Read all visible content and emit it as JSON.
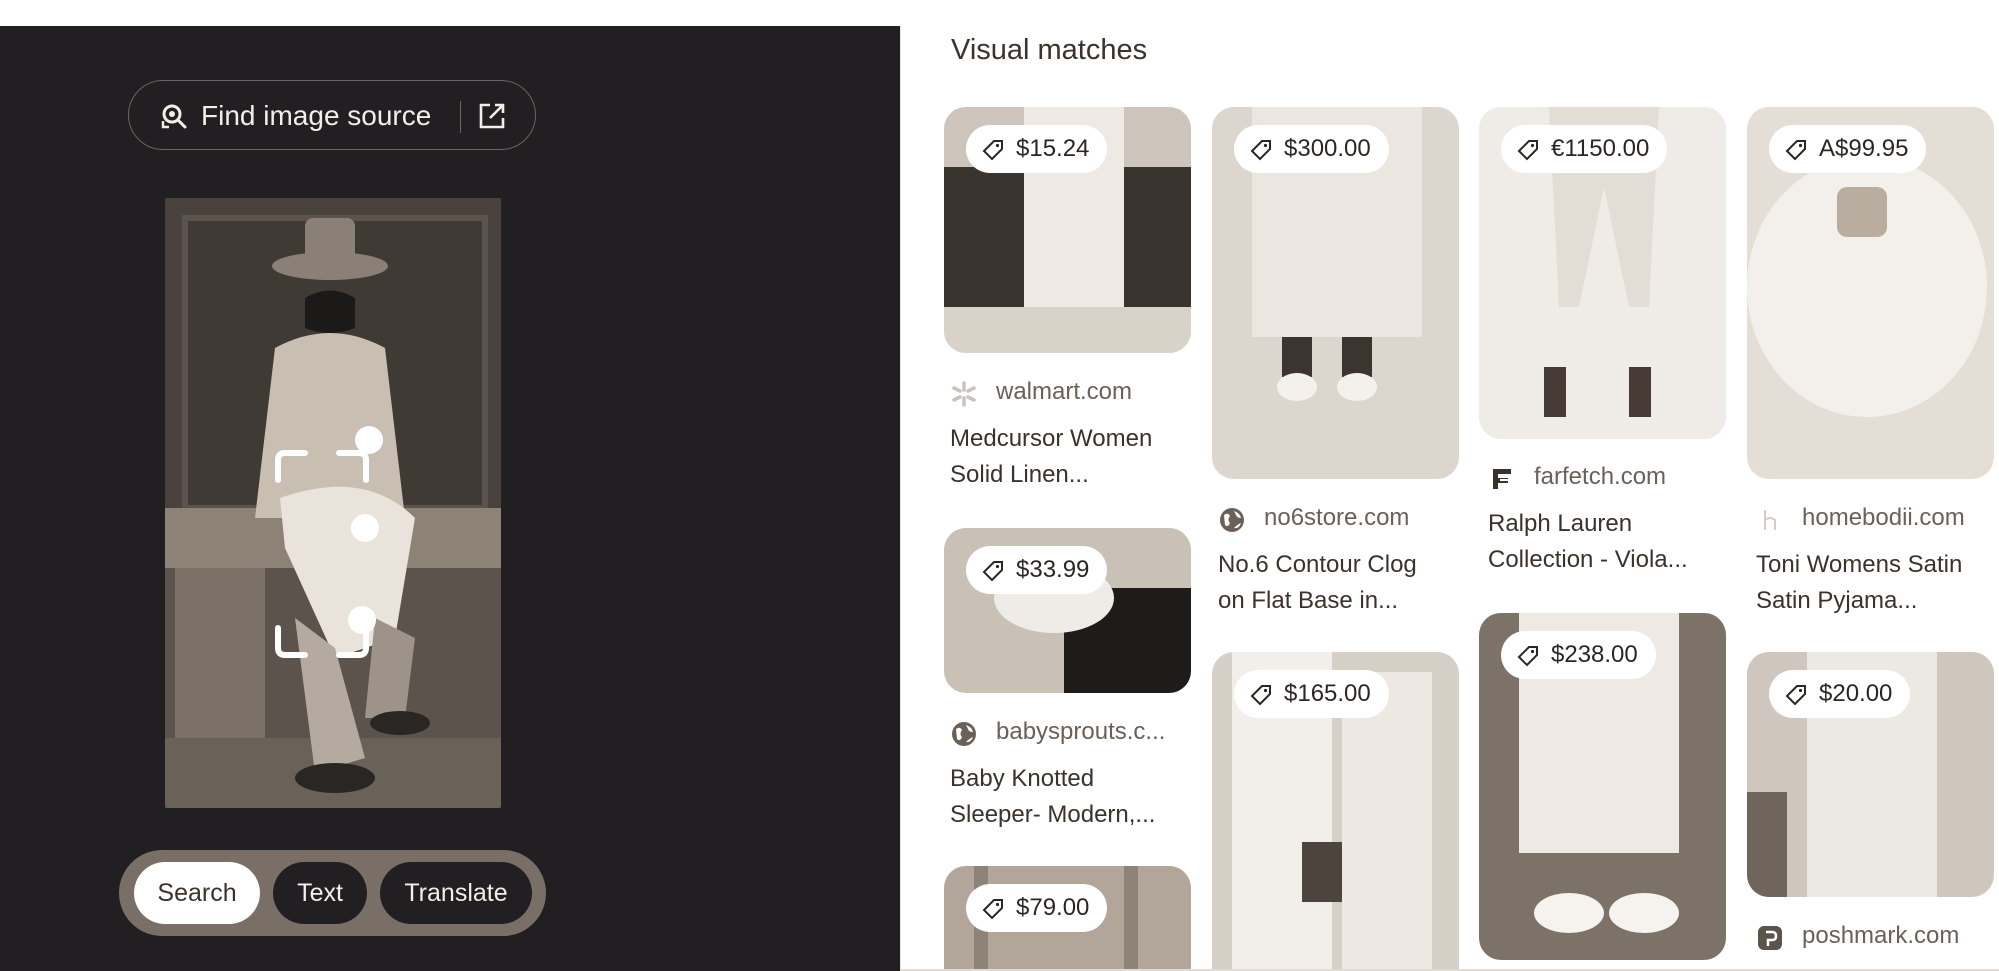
{
  "lens_panel": {
    "find_image_source_label": "Find image source",
    "modes": [
      {
        "label": "Search",
        "active": true
      },
      {
        "label": "Text",
        "active": false
      },
      {
        "label": "Translate",
        "active": false
      }
    ]
  },
  "results": {
    "section_title": "Visual matches",
    "items": [
      {
        "price": "$15.24",
        "source": "walmart.com",
        "source_icon": "walmart-spark-icon",
        "title_line1": "Medcursor Women",
        "title_line2": "Solid Linen..."
      },
      {
        "price": "$33.99",
        "source": "babysprouts.c...",
        "source_icon": "globe-icon",
        "title_line1": "Baby Knotted",
        "title_line2": "Sleeper- Modern,..."
      },
      {
        "price": "$79.00"
      },
      {
        "price": "$300.00",
        "source": "no6store.com",
        "source_icon": "globe-icon",
        "title_line1": "No.6 Contour Clog",
        "title_line2": "on Flat Base in..."
      },
      {
        "price": "$165.00"
      },
      {
        "price": "€1150.00",
        "source": "farfetch.com",
        "source_icon": "farfetch-icon",
        "title_line1": "Ralph Lauren",
        "title_line2": "Collection - Viola..."
      },
      {
        "price": "$238.00"
      },
      {
        "price": "A$99.95",
        "source": "homebodii.com",
        "source_icon": "homebodii-icon",
        "title_line1": "Toni Womens Satin",
        "title_line2": "Satin Pyjama..."
      },
      {
        "price": "$20.00",
        "source": "poshmark.com",
        "source_icon": "poshmark-icon"
      }
    ]
  },
  "colors": {
    "left_bg": "#211f21",
    "chip_bar": "#7a6f66",
    "text_dark": "#3b322b",
    "text_muted": "#6a6058"
  }
}
